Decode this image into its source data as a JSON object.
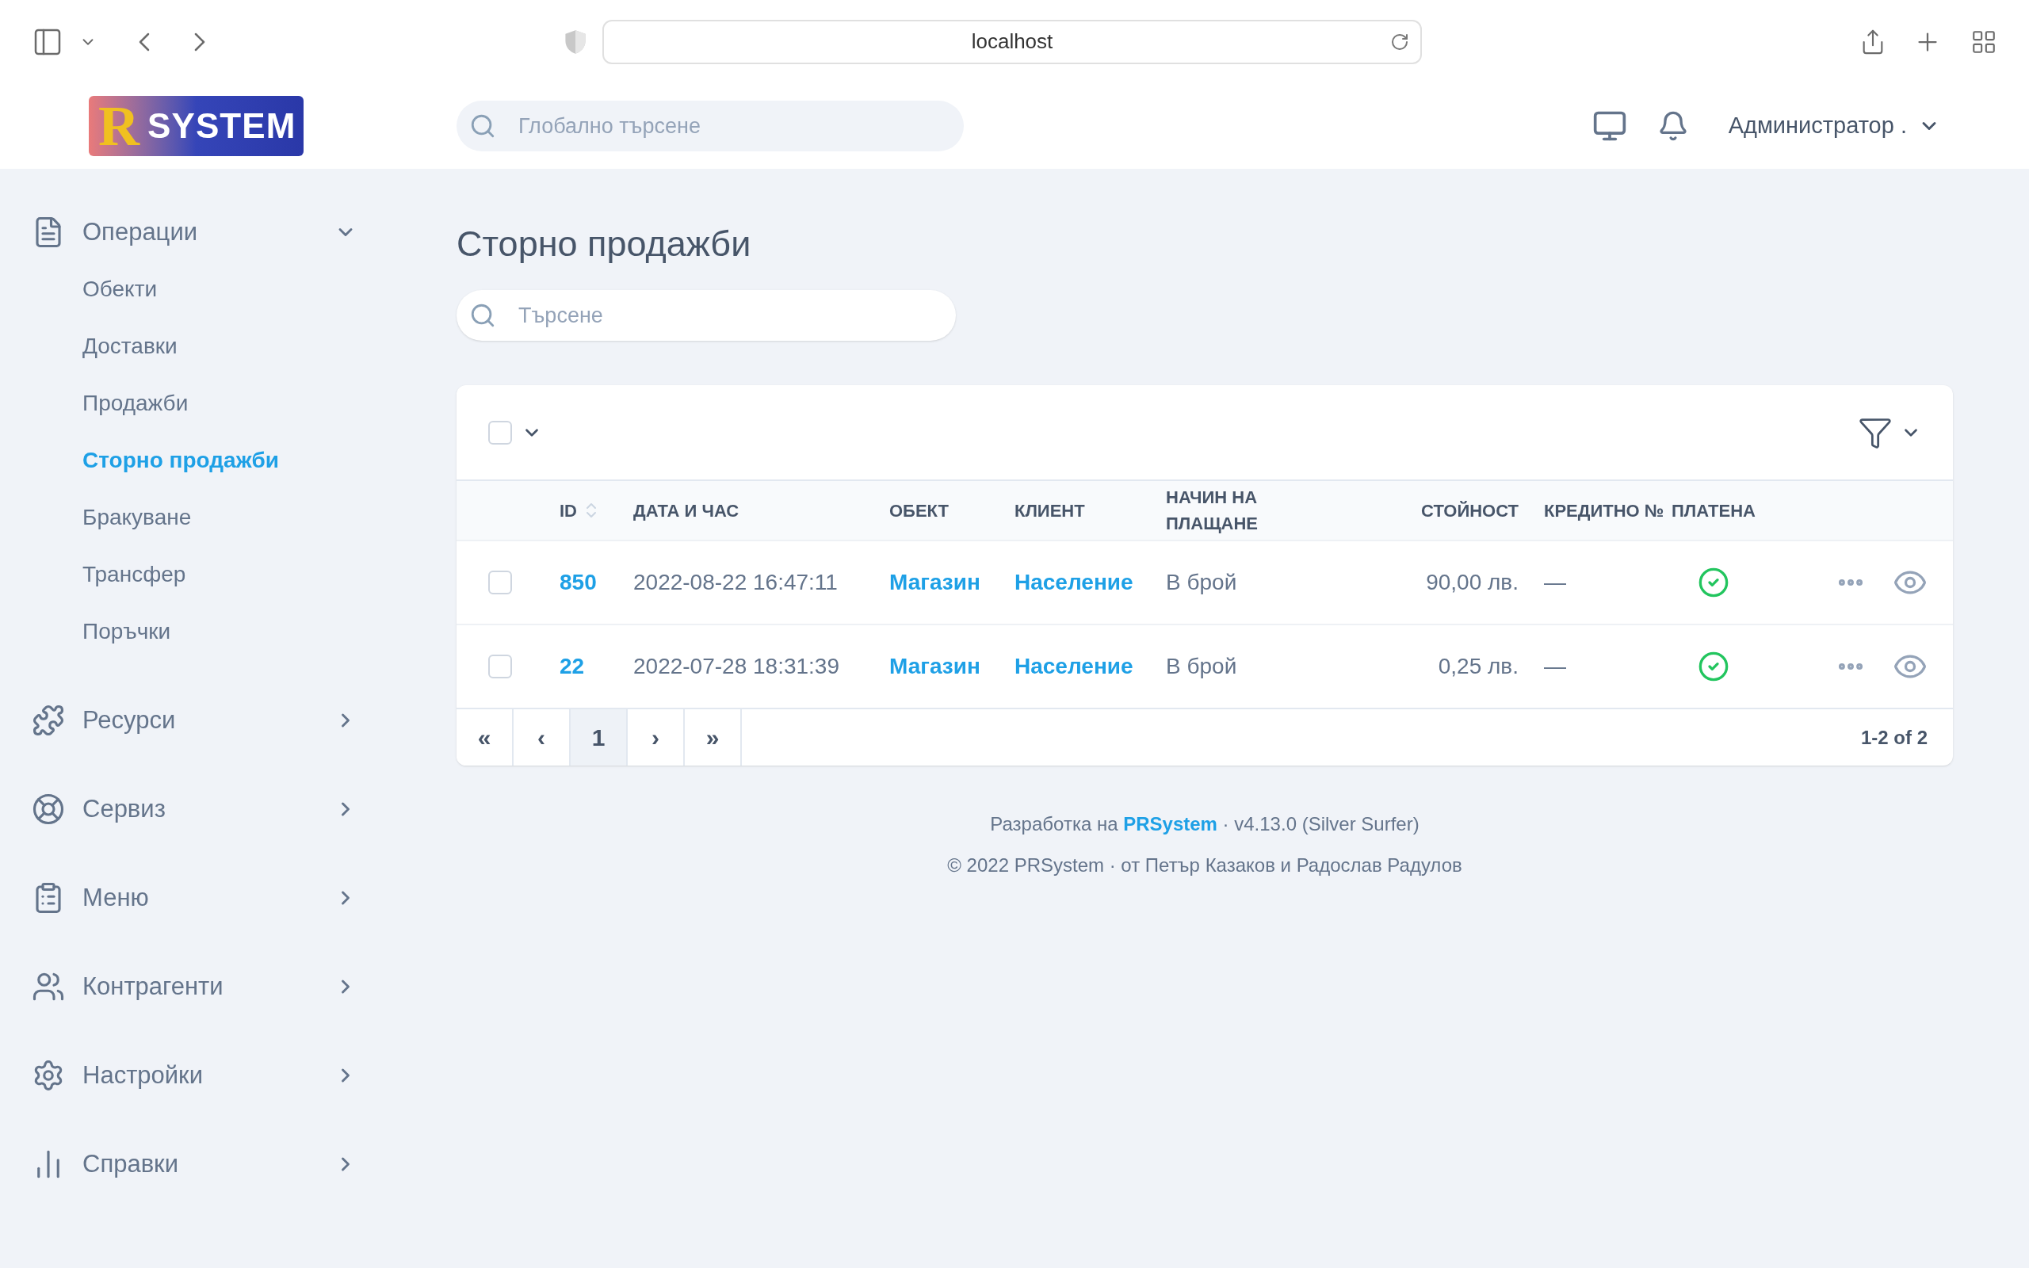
{
  "browser": {
    "url": "localhost"
  },
  "header": {
    "logo": {
      "letter": "R",
      "text": "SYSTEM"
    },
    "search_placeholder": "Глобално търсене",
    "user": "Администратор ."
  },
  "sidebar": [
    {
      "label": "Операции",
      "expanded": true,
      "children": [
        {
          "label": "Обекти",
          "selected": false
        },
        {
          "label": "Доставки",
          "selected": false
        },
        {
          "label": "Продажби",
          "selected": false
        },
        {
          "label": "Сторно продажби",
          "selected": true
        },
        {
          "label": "Бракуване",
          "selected": false
        },
        {
          "label": "Трансфер",
          "selected": false
        },
        {
          "label": "Поръчки",
          "selected": false
        }
      ]
    },
    {
      "label": "Ресурси",
      "expanded": false
    },
    {
      "label": "Сервиз",
      "expanded": false
    },
    {
      "label": "Меню",
      "expanded": false
    },
    {
      "label": "Контрагенти",
      "expanded": false
    },
    {
      "label": "Настройки",
      "expanded": false
    },
    {
      "label": "Справки",
      "expanded": false
    }
  ],
  "page": {
    "title": "Сторно продажби",
    "search_placeholder": "Търсене"
  },
  "table": {
    "select_all_checked": false,
    "columns": [
      "ID",
      "ДАТА И ЧАС",
      "ОБЕКТ",
      "КЛИЕНТ",
      "НАЧИН НА ПЛАЩАНЕ",
      "СТОЙНОСТ",
      "КРЕДИТНО №",
      "ПЛАТЕНА"
    ],
    "rows": [
      {
        "checked": false,
        "id": "850",
        "datetime": "2022-08-22 16:47:11",
        "object": "Магазин",
        "client": "Население",
        "payment": "В брой",
        "value": "90,00 лв.",
        "credit": "—",
        "paid": true
      },
      {
        "checked": false,
        "id": "22",
        "datetime": "2022-07-28 18:31:39",
        "object": "Магазин",
        "client": "Население",
        "payment": "В брой",
        "value": "0,25 лв.",
        "credit": "—",
        "paid": true
      }
    ],
    "pagination": [
      {
        "label": "«",
        "selected": false
      },
      {
        "label": "‹",
        "selected": false
      },
      {
        "label": "1",
        "selected": true
      },
      {
        "label": "›",
        "selected": false
      },
      {
        "label": "»",
        "selected": false
      }
    ],
    "range": "1-2 of 2"
  },
  "footer": {
    "line1": "Разработка на **PRSystem** · v4.13.0 (Silver Surfer)",
    "line2": "© 2022 PRSystem · от Петър Казаков и Радослав Радулов"
  }
}
